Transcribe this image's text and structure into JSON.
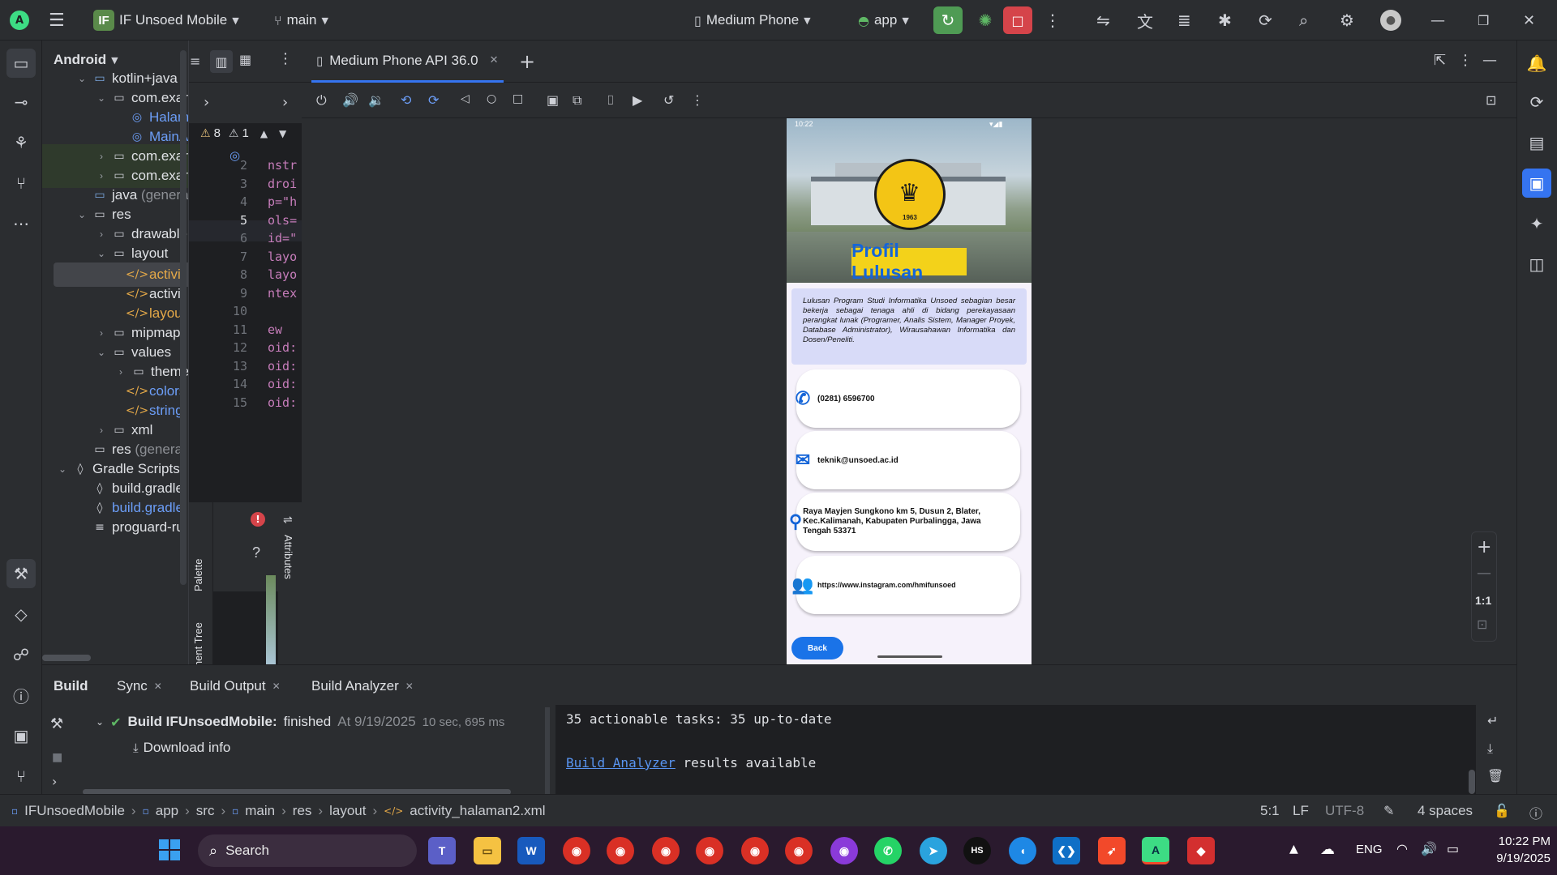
{
  "titlebar": {
    "project_badge": "IF",
    "project_name": "IF Unsoed Mobile",
    "branch": "main",
    "device": "Medium Phone",
    "run_config": "app"
  },
  "project_panel": {
    "view": "Android",
    "items": [
      {
        "label": "kotlin+java"
      },
      {
        "label": "com.exar"
      },
      {
        "label": "Halam"
      },
      {
        "label": "MainA"
      },
      {
        "label": "com.exar"
      },
      {
        "label": "com.exar"
      },
      {
        "label": "java",
        "suffix": "(genera"
      },
      {
        "label": "res"
      },
      {
        "label": "drawable"
      },
      {
        "label": "layout"
      },
      {
        "label": "activit"
      },
      {
        "label": "activit"
      },
      {
        "label": "layou"
      },
      {
        "label": "mipmap"
      },
      {
        "label": "values"
      },
      {
        "label": "theme"
      },
      {
        "label": "colors"
      },
      {
        "label": "string"
      },
      {
        "label": "xml"
      },
      {
        "label": "res",
        "suffix": "(generat"
      },
      {
        "label": "Gradle Scripts"
      },
      {
        "label": "build.gradle."
      },
      {
        "label": "build.gradle."
      },
      {
        "label": "proguard-rul"
      }
    ]
  },
  "editor": {
    "warnings": "8",
    "weak_warnings": "1",
    "line_numbers": [
      "2",
      "3",
      "4",
      "5",
      "6",
      "7",
      "8",
      "9",
      "10",
      "11",
      "12",
      "13",
      "14",
      "15"
    ],
    "code_lines": [
      "nstr",
      "droi",
      "p=\"h",
      "ols=",
      "id=\"",
      "layo",
      "layo",
      "ntex",
      "",
      "ew",
      "oid:",
      "oid:",
      "oid:",
      "oid:"
    ],
    "palette_label": "Palette",
    "component_tree_label": "Component Tree",
    "attributes_label": "Attributes",
    "help_label": "?"
  },
  "running_devices": {
    "tab_label": "Medium Phone API 36.0",
    "zoom_label": "1:1"
  },
  "app_screen": {
    "status_time": "10:22",
    "hero_title": "Profil Lulusan",
    "seal_year": "1963",
    "description": "Lulusan Program Studi Informatika Unsoed sebagian besar bekerja sebagai tenaga ahli di bidang perekayasaan perangkat lunak (Programer, Analis Sistem, Manager Proyek, Database Administrator), Wirausahawan Informatika dan Dosen/Peneliti.",
    "contacts": [
      {
        "icon": "phone-icon",
        "text": "(0281) 6596700"
      },
      {
        "icon": "mail-icon",
        "text": "teknik@unsoed.ac.id"
      },
      {
        "icon": "location-pin-icon",
        "text": "Raya Mayjen Sungkono km 5, Dusun 2, Blater, Kec.Kalimanah, Kabupaten Purbalingga, Jawa Tengah 53371"
      },
      {
        "icon": "people-icon",
        "text": "https://www.instagram.com/hmifunsoed"
      }
    ],
    "back_button": "Back",
    "accent": "#1a73e8"
  },
  "build": {
    "tabs": [
      "Build",
      "Sync",
      "Build Output",
      "Build Analyzer"
    ],
    "result_title": "Build IFUnsoedMobile:",
    "result_status": "finished",
    "result_time": "At 9/19/2025",
    "result_duration": "10 sec, 695 ms",
    "download_info": "Download info",
    "output_line1": "35 actionable tasks: 35 up-to-date",
    "output_link": "Build Analyzer",
    "output_line2_rest": " results available"
  },
  "statusbar": {
    "breadcrumb": [
      "IFUnsoedMobile",
      "app",
      "src",
      "main",
      "res",
      "layout",
      "activity_halaman2.xml"
    ],
    "position": "5:1",
    "line_ending": "LF",
    "encoding": "UTF-8",
    "indent": "4 spaces"
  },
  "taskbar": {
    "search_placeholder": "Search",
    "language": "ENG",
    "time": "10:22 PM",
    "date": "9/19/2025"
  }
}
